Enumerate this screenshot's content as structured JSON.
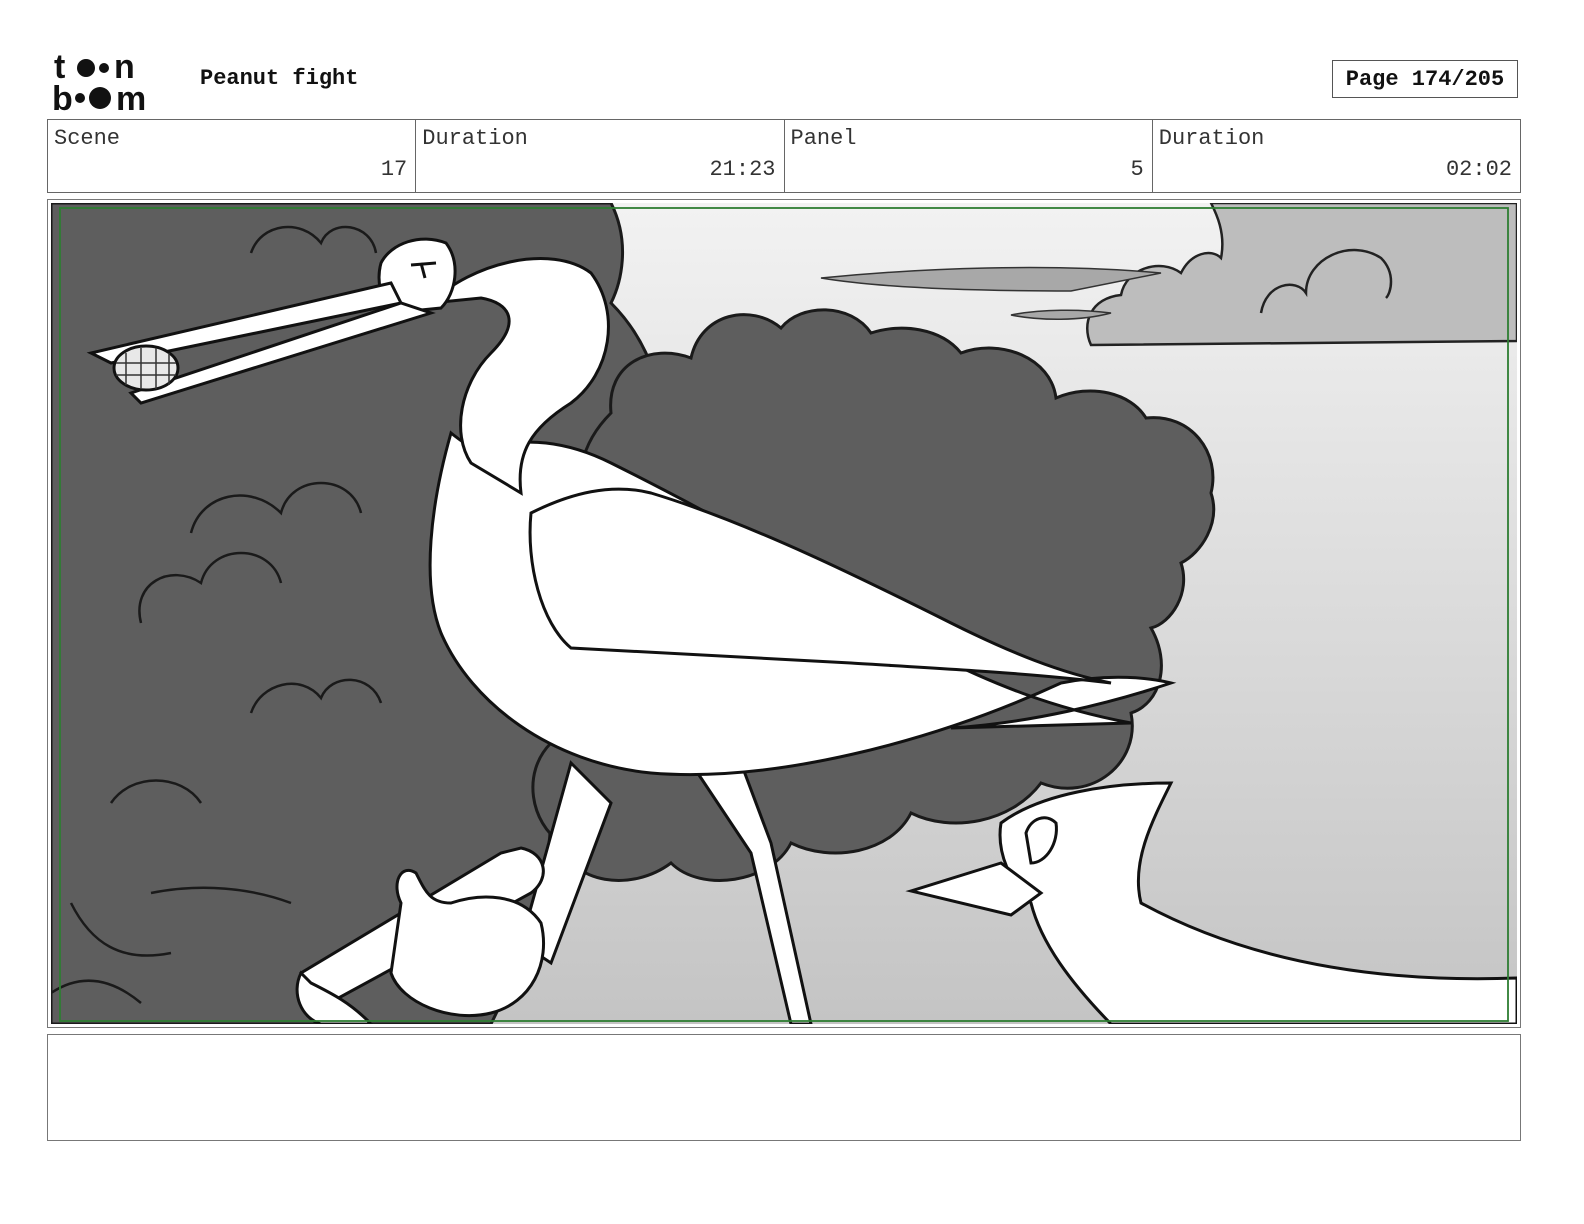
{
  "header": {
    "logo_alt": "toon boom",
    "project_title": "Peanut fight",
    "page_label": "Page 174/205"
  },
  "info": {
    "scene": {
      "label": "Scene",
      "value": "17"
    },
    "scene_duration": {
      "label": "Duration",
      "value": "21:23"
    },
    "panel": {
      "label": "Panel",
      "value": "5"
    },
    "panel_duration": {
      "label": "Duration",
      "value": "02:02"
    }
  },
  "panel": {
    "description": "",
    "colors": {
      "safe_frame": "#2e7d32",
      "dark_fill": "#5e5e5e",
      "sky_top": "#f2f2f2",
      "sky_bottom": "#c9c9c9"
    }
  },
  "notes": {
    "text": ""
  }
}
